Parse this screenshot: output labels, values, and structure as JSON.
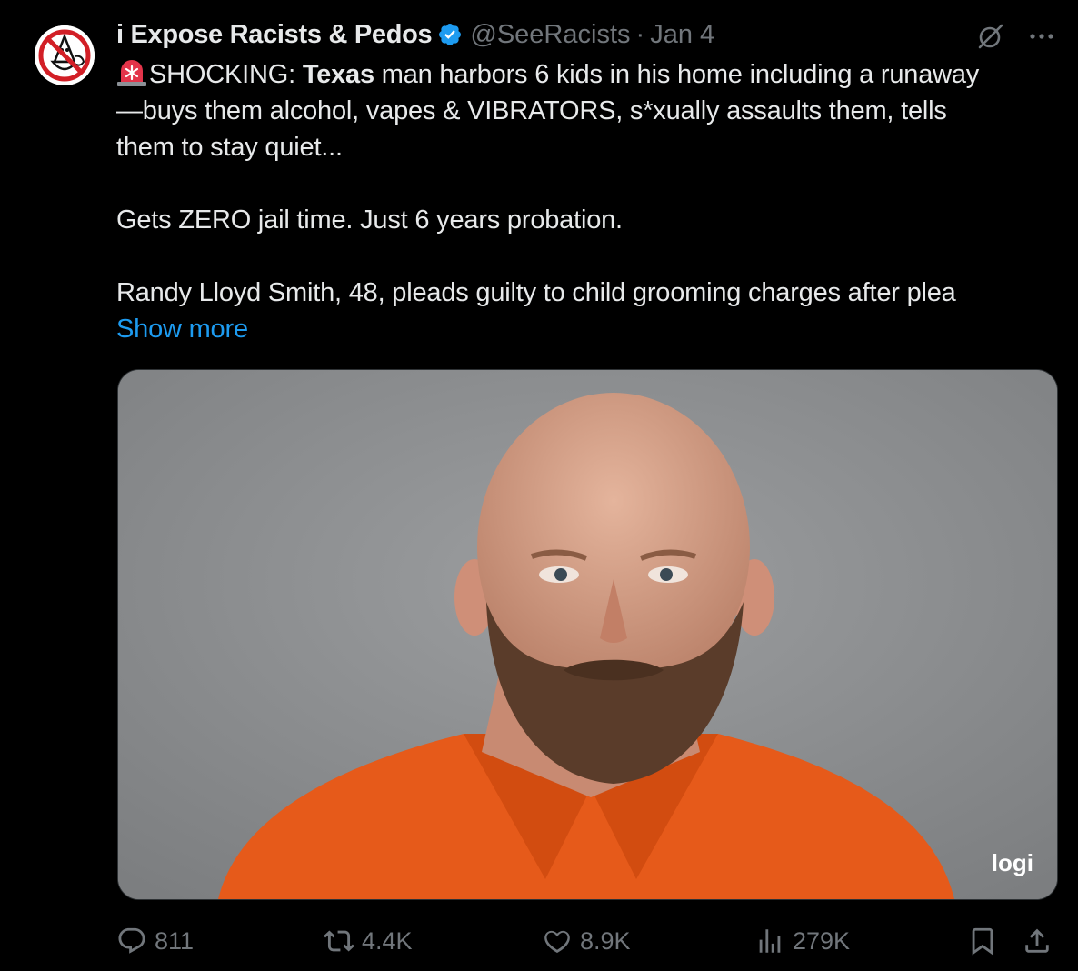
{
  "author": {
    "display_name": "i Expose Racists & Pedos",
    "handle": "@SeeRacists",
    "separator": "·",
    "date": "Jan 4",
    "verified_color": "#1d9bf0"
  },
  "icons": {
    "grok": "grok-icon",
    "more": "more-icon",
    "siren": "siren-emoji",
    "reply": "reply-icon",
    "retweet": "retweet-icon",
    "like": "like-icon",
    "views": "views-icon",
    "bookmark": "bookmark-icon",
    "share": "share-icon"
  },
  "tweet": {
    "line1_rest_a": "SHOCKING: ",
    "line1_bold": "Texas",
    "line1_rest_b": " man harbors 6 kids in his home including a runaway",
    "line2": "—buys them alcohol, vapes & VIBRATORS, s*xually assaults them, tells",
    "line3": "them to stay quiet...",
    "line4": "Gets ZERO jail time. Just 6 years probation.",
    "line5": "Randy Lloyd Smith, 48, pleads guilty to child grooming charges after plea",
    "show_more": "Show more"
  },
  "media": {
    "watermark": "logi"
  },
  "stats": {
    "replies": "811",
    "retweets": "4.4K",
    "likes": "8.9K",
    "views": "279K"
  },
  "colors": {
    "background": "#000000",
    "text": "#e7e9ea",
    "muted": "#71767b",
    "link": "#1d9bf0"
  }
}
